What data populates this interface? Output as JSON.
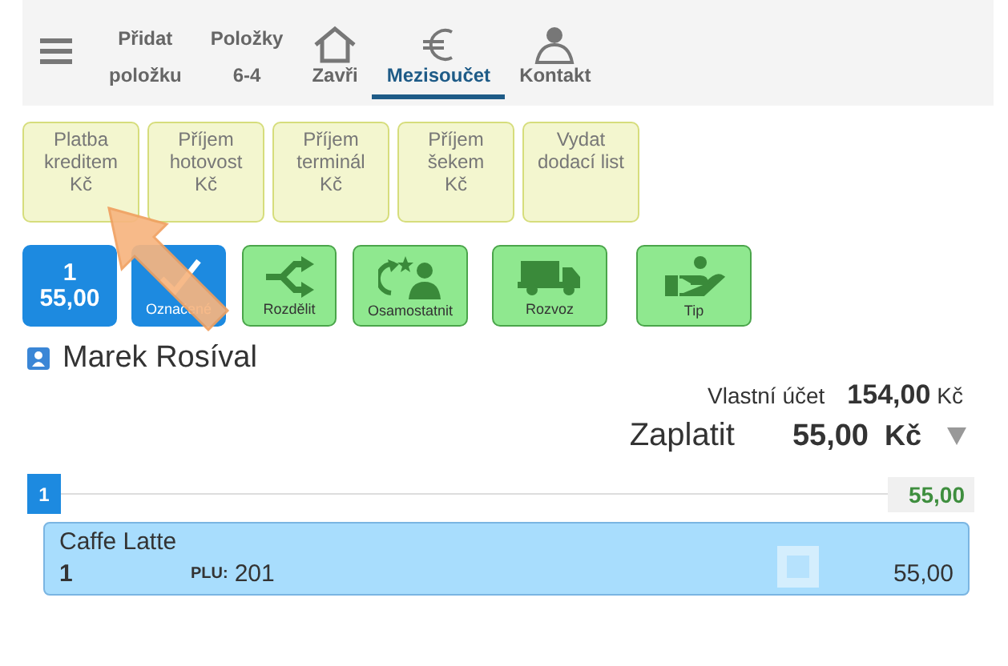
{
  "nav": {
    "tabs": [
      {
        "kind": "text",
        "lines": [
          "Přidat",
          "položku"
        ],
        "selected": false
      },
      {
        "kind": "text",
        "lines": [
          "Položky",
          "6-4"
        ],
        "selected": false
      },
      {
        "kind": "house",
        "lines": [
          "Zavři"
        ],
        "selected": false
      },
      {
        "kind": "euro",
        "lines": [
          "Mezisoučet"
        ],
        "selected": true
      },
      {
        "kind": "person",
        "lines": [
          "Kontakt"
        ],
        "selected": false
      }
    ]
  },
  "payment_buttons": [
    {
      "lines": [
        "Platba",
        "kreditem",
        "Kč"
      ]
    },
    {
      "lines": [
        "Příjem",
        "hotovost",
        "Kč"
      ]
    },
    {
      "lines": [
        "Příjem",
        "terminál",
        "Kč"
      ]
    },
    {
      "lines": [
        "Příjem",
        "šekem",
        "Kč"
      ]
    },
    {
      "lines": [
        "Vydat",
        "dodací list"
      ]
    }
  ],
  "actions": [
    {
      "kind": "count",
      "lines": [
        "1",
        "55,00"
      ]
    },
    {
      "kind": "marked",
      "label": "Označené"
    },
    {
      "kind": "split",
      "label": "Rozdělit"
    },
    {
      "kind": "separate",
      "label": "Osamostatnit"
    },
    {
      "kind": "delivery",
      "label": "Rozvoz"
    },
    {
      "kind": "tip",
      "label": "Tip"
    }
  ],
  "customer": {
    "name": "Marek Rosíval"
  },
  "totals": {
    "own_label": "Vlastní účet",
    "own_amount": "154,00",
    "own_currency": "Kč",
    "pay_label": "Zaplatit",
    "pay_amount": "55,00",
    "pay_currency": "Kč"
  },
  "groups": [
    {
      "number": "1",
      "total": "55,00",
      "items": [
        {
          "name": "Caffe Latte",
          "qty": "1",
          "plu_label": "PLU:",
          "plu": "201",
          "price": "55,00",
          "checked": false
        }
      ]
    }
  ]
}
